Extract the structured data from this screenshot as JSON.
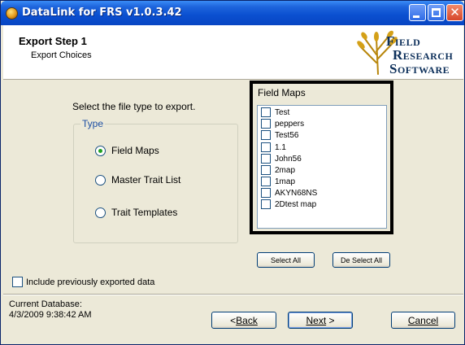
{
  "window": {
    "title": "DataLink for FRS v1.0.3.42",
    "controls": [
      "minimize-icon",
      "maximize-icon",
      "close-icon"
    ]
  },
  "header": {
    "step_title": "Export Step 1",
    "step_subtitle": "Export Choices",
    "logo": {
      "line1": "IELD",
      "line2": "ESEARCH",
      "line3": "OFTWARE",
      "cap1": "F",
      "cap2": "R",
      "cap3": "S",
      "alt": "Field Research Software"
    }
  },
  "export": {
    "prompt": "Select the file type to export.",
    "type_group_label": "Type",
    "options": [
      {
        "label": "Field Maps",
        "selected": true
      },
      {
        "label": "Master Trait List",
        "selected": false
      },
      {
        "label": "Trait Templates",
        "selected": false
      }
    ]
  },
  "field_maps": {
    "title": "Field Maps",
    "items": [
      "Test",
      "peppers",
      "Test56",
      "1.1",
      "John56",
      "2map",
      "1map",
      "AKYN68NS",
      "2Dtest map"
    ],
    "select_all_label": "Select All",
    "deselect_all_label": "De Select All"
  },
  "include_previous": {
    "label": "Include previously exported data",
    "checked": false
  },
  "database": {
    "label": "Current Database:",
    "value": "4/3/2009 9:38:42 AM"
  },
  "buttons": {
    "back": "Back",
    "next": "Next",
    "cancel": "Cancel"
  },
  "colors": {
    "titlebar": "#0a4fd0",
    "dialog_bg": "#ece9d8",
    "group_label": "#1d4fa3",
    "radio_dot": "#21a121"
  }
}
